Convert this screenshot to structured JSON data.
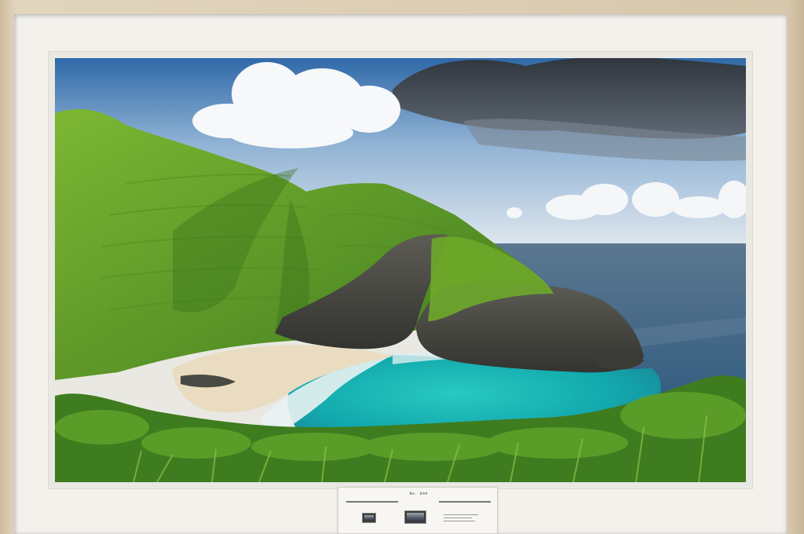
{
  "artwork": {
    "subject": "coastal-landscape-photograph"
  },
  "caption_card": {
    "id_text": "No. 844"
  },
  "colors": {
    "frame_wood": "#d8c9b1",
    "mat": "#f2f1ec",
    "sky": "#3d78b4",
    "grass": "#6fa82a",
    "lagoon": "#16b3b0",
    "ocean": "#3b5b7a",
    "sand": "#e9dcc0",
    "rock": "#4a4a46"
  }
}
